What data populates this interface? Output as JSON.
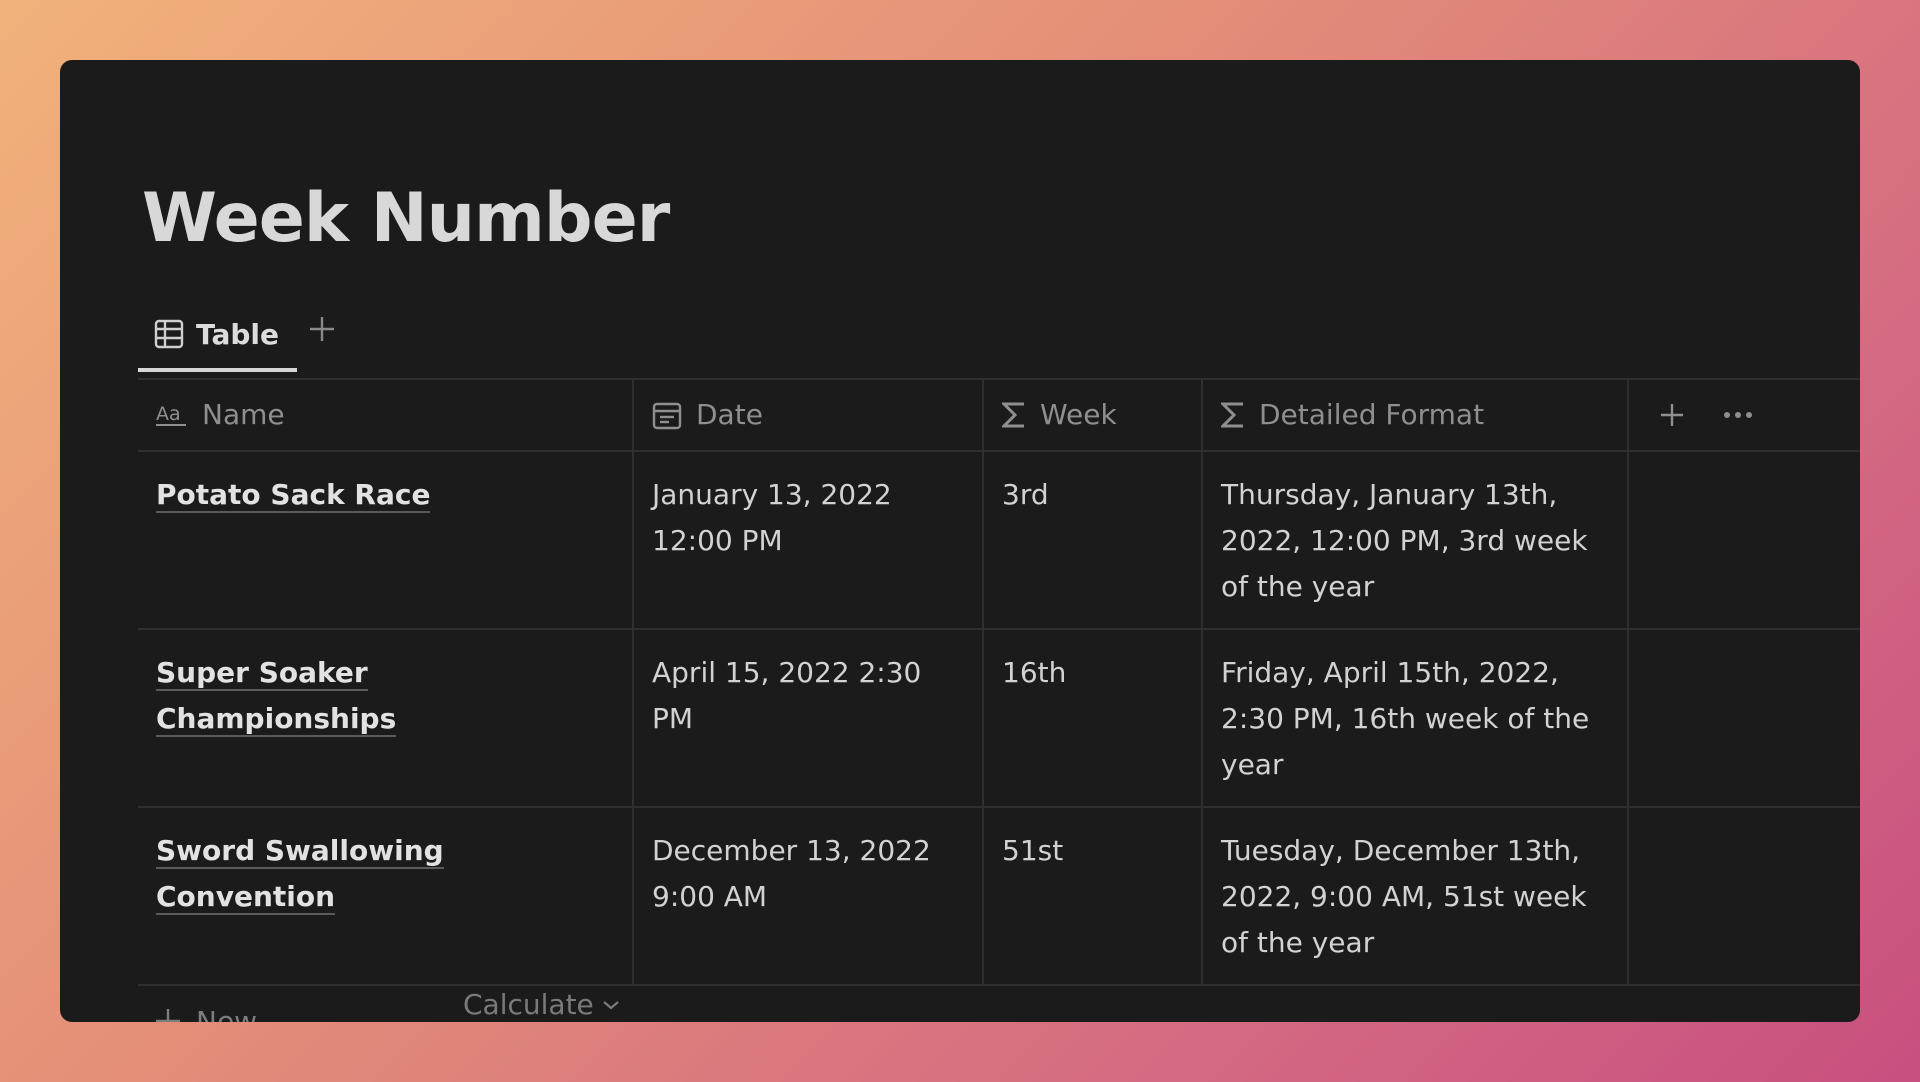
{
  "page": {
    "title": "Week Number"
  },
  "views": {
    "active_tab_label": "Table",
    "icons": {
      "tab": "table-icon",
      "add": "plus-icon"
    }
  },
  "table": {
    "columns": [
      {
        "label": "Name",
        "icon": "text-aa-icon"
      },
      {
        "label": "Date",
        "icon": "calendar-icon"
      },
      {
        "label": "Week",
        "icon": "sigma-icon"
      },
      {
        "label": "Detailed Format",
        "icon": "sigma-icon"
      }
    ],
    "rows": [
      {
        "name": "Potato Sack Race",
        "date": "January 13, 2022 12:00 PM",
        "week": "3rd",
        "detailed": "Thursday, January 13th, 2022, 12:00 PM, 3rd week of the year"
      },
      {
        "name": "Super Soaker Championships",
        "date": "April 15, 2022 2:30 PM",
        "week": "16th",
        "detailed": "Friday, April 15th, 2022, 2:30 PM, 16th week of the year"
      },
      {
        "name": "Sword Swallowing Convention",
        "date": "December 13, 2022 9:00 AM",
        "week": "51st",
        "detailed": "Tuesday, December 13th, 2022, 9:00 AM, 51st week of the year"
      }
    ],
    "new_row_label": "New",
    "calculate_label": "Calculate"
  },
  "colors": {
    "window_bg": "#1b1b1b",
    "text": "#d2d2d2",
    "muted": "#8f8f8f",
    "border": "#2f2f2f"
  }
}
